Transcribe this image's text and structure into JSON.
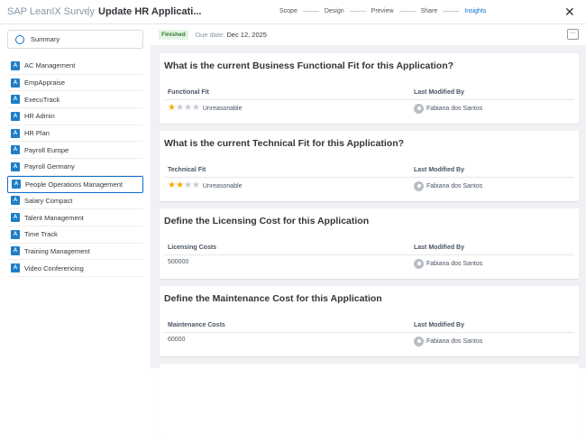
{
  "header": {
    "brand": "SAP LeanIX Survey",
    "separator": "|",
    "title": "Update HR Applicati...",
    "steps": [
      "Scope",
      "Design",
      "Preview",
      "Share",
      "Insights"
    ],
    "active_step": "Insights"
  },
  "sidebar": {
    "summary": "Summary",
    "badge": "A",
    "items": [
      "AC Management",
      "EmpAppraise",
      "ExecuTrack",
      "HR Admin",
      "HR Plan",
      "Payroll Europe",
      "Payroll Germany",
      "People Operations Management",
      "Salary Compact",
      "Talent Management",
      "Time Track",
      "Training Management",
      "Video Conferencing"
    ],
    "selected": "People Operations Management"
  },
  "status": {
    "badge": "Finished",
    "due_label": "Due date:",
    "due_value": "Dec 12, 2025",
    "more": "···"
  },
  "cards": [
    {
      "question": "What is the current Business Functional Fit for this Application?",
      "field": "Functional Fit",
      "value": "Unreasonable",
      "rating": 1,
      "max": 4,
      "modified_label": "Last Modified By",
      "modified_by": "Fabiana dos Santos"
    },
    {
      "question": "What is the current Technical Fit for this Application?",
      "field": "Technical Fit",
      "value": "Unreasonable",
      "rating": 2,
      "max": 4,
      "modified_label": "Last Modified By",
      "modified_by": "Fabiana dos Santos"
    },
    {
      "question": "Define the Licensing Cost for this Application",
      "field": "Licensing Costs",
      "value": "500000",
      "modified_label": "Last Modified By",
      "modified_by": "Fabiana dos Santos"
    },
    {
      "question": "Define the Maintenance Cost for this Application",
      "field": "Maintenance Costs",
      "value": "60000",
      "modified_label": "Last Modified By",
      "modified_by": "Fabiana dos Santos"
    }
  ]
}
